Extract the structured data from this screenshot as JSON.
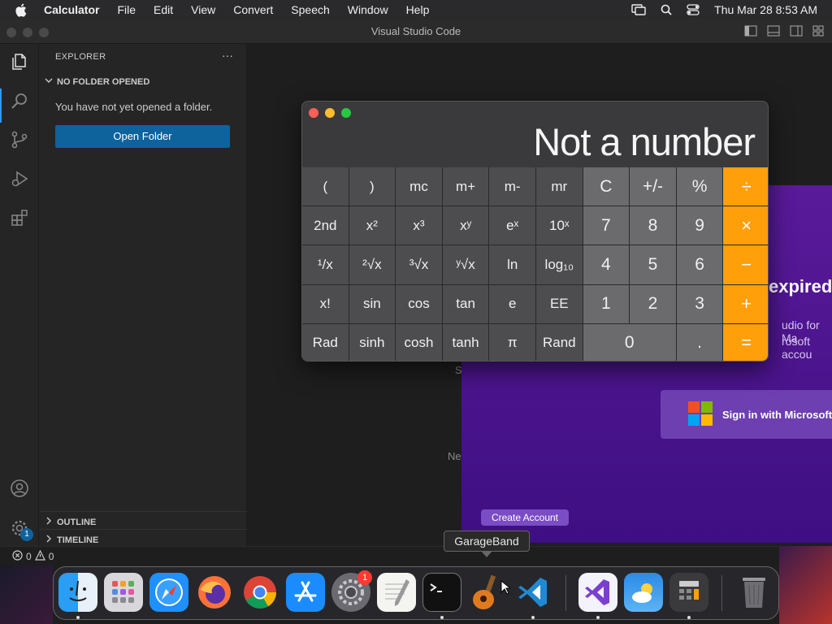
{
  "menubar": {
    "app_name": "Calculator",
    "items": [
      "File",
      "Edit",
      "View",
      "Convert",
      "Speech",
      "Window",
      "Help"
    ],
    "clock": "Thu Mar 28  8:53 AM"
  },
  "vscode": {
    "window_title": "Visual Studio Code",
    "explorer_title": "EXPLORER",
    "more": "···",
    "no_folder": "NO FOLDER OPENED",
    "message": "You have not yet opened a folder.",
    "open_folder": "Open Folder",
    "outline": "OUTLINE",
    "timeline": "TIMELINE",
    "errors": "0",
    "warnings": "0",
    "account_badge": "1"
  },
  "welcome": {
    "expired": "expired",
    "line1": "udio for Ma",
    "line2": "rosoft accou",
    "sign_in": "Sign in with Microsoft",
    "create_account": "Create Account",
    "ghost_s": "S",
    "ghost_ne": "Ne"
  },
  "calculator": {
    "display": "Not a number",
    "rows": [
      [
        "(",
        ")",
        "mc",
        "m+",
        "m-",
        "mr",
        "C",
        "+/-",
        "%",
        "÷"
      ],
      [
        "2nd",
        "x²",
        "x³",
        "xʸ",
        "eˣ",
        "10ˣ",
        "7",
        "8",
        "9",
        "×"
      ],
      [
        "¹/x",
        "²√x",
        "³√x",
        "ʸ√x",
        "ln",
        "log₁₀",
        "4",
        "5",
        "6",
        "−"
      ],
      [
        "x!",
        "sin",
        "cos",
        "tan",
        "e",
        "EE",
        "1",
        "2",
        "3",
        "+"
      ],
      [
        "Rad",
        "sinh",
        "cosh",
        "tanh",
        "π",
        "Rand",
        "0",
        ".",
        "="
      ]
    ]
  },
  "dock": {
    "tooltip": "GarageBand",
    "settings_badge": "1",
    "apps": [
      "finder-icon",
      "launchpad-icon",
      "safari-icon",
      "firefox-icon",
      "chrome-icon",
      "app-store-icon",
      "system-settings-icon",
      "textedit-icon",
      "terminal-icon",
      "garageband-icon",
      "vscode-icon",
      "visual-studio-icon",
      "weather-icon",
      "calculator-icon",
      "trash-icon"
    ]
  },
  "colors": {
    "accent_blue": "#0e639c",
    "calc_operator": "#ff9f0a",
    "welcome_purple": "#5a1a9a"
  }
}
